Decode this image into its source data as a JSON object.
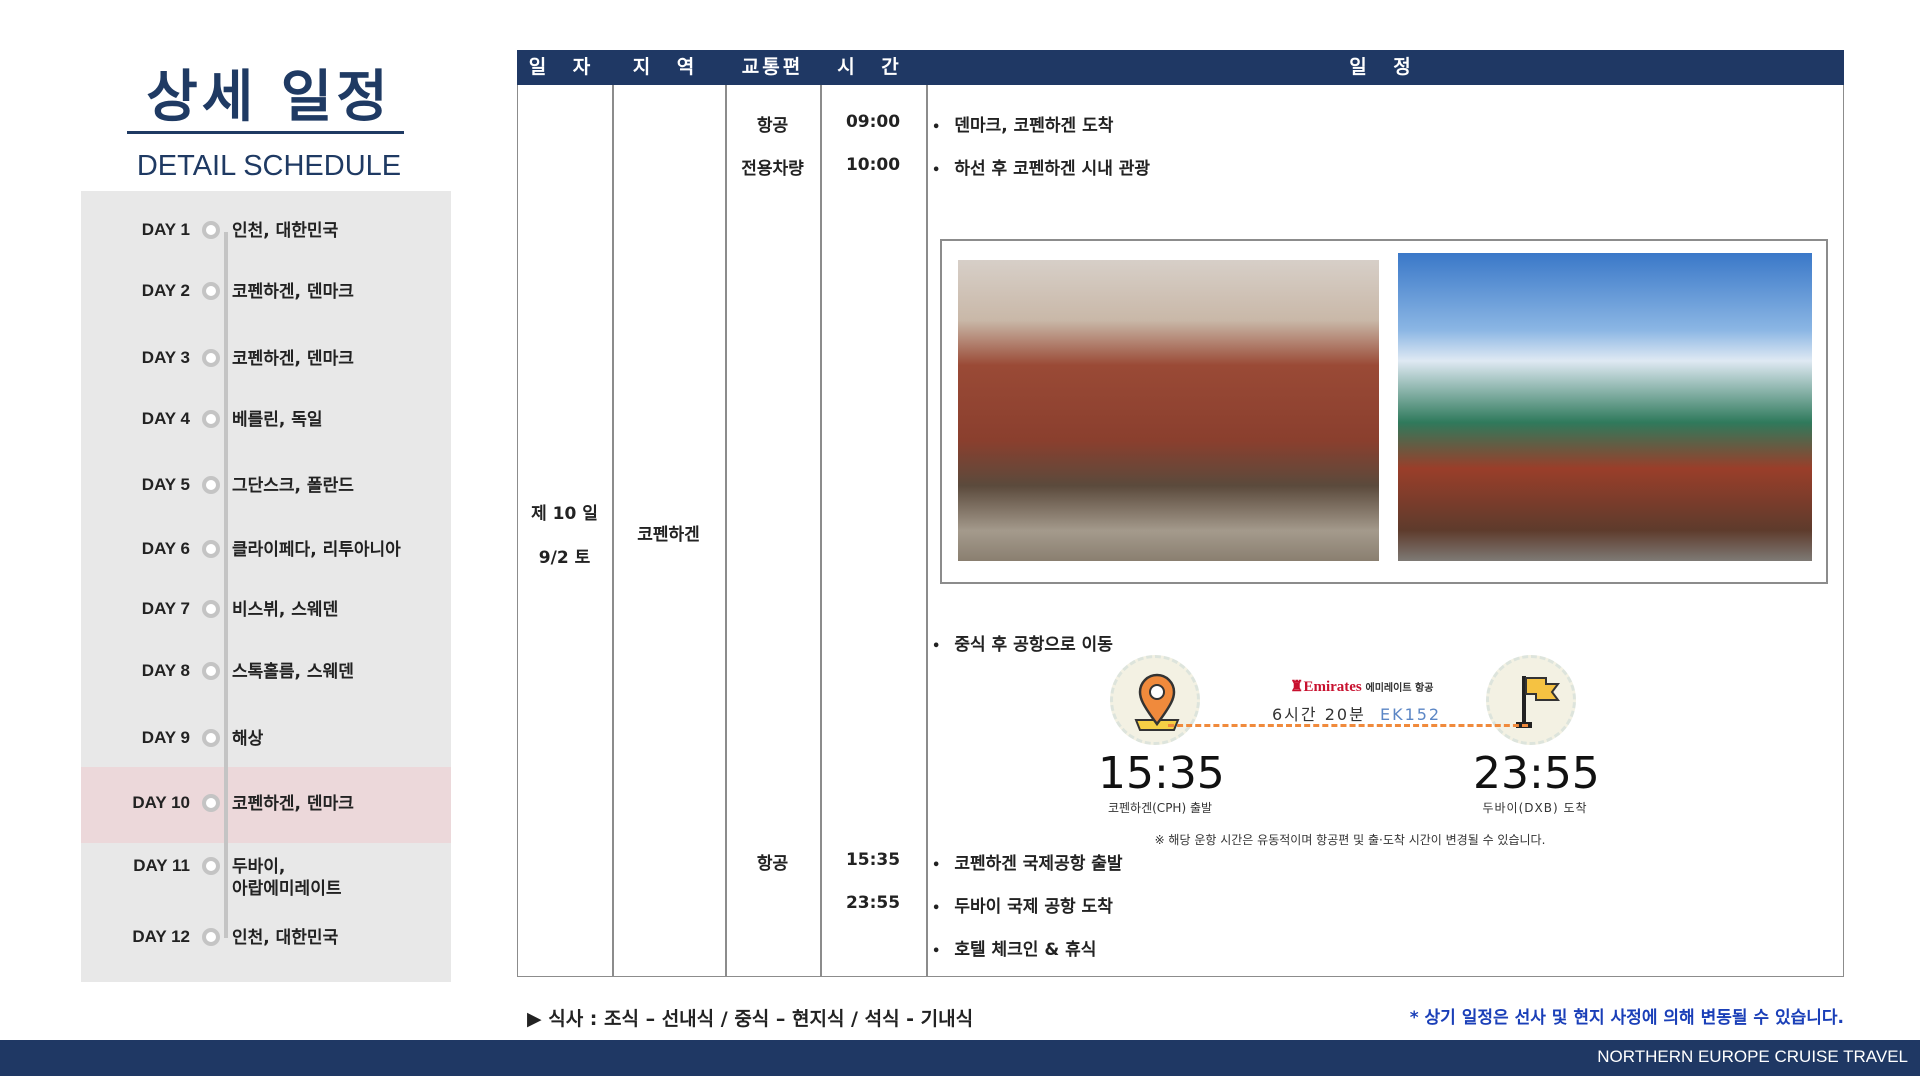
{
  "header": {
    "title": "상세 일정",
    "subtitle": "DETAIL SCHEDULE"
  },
  "sidebar": {
    "items": [
      {
        "day": "DAY 1",
        "place": "인천, 대한민국"
      },
      {
        "day": "DAY 2",
        "place": "코펜하겐, 덴마크"
      },
      {
        "day": "DAY 3",
        "place": "코펜하겐, 덴마크"
      },
      {
        "day": "DAY 4",
        "place": "베를린, 독일"
      },
      {
        "day": "DAY 5",
        "place": "그단스크, 폴란드"
      },
      {
        "day": "DAY 6",
        "place": "클라이페다, 리투아니아"
      },
      {
        "day": "DAY 7",
        "place": "비스뷔, 스웨덴"
      },
      {
        "day": "DAY 8",
        "place": "스톡홀름, 스웨덴"
      },
      {
        "day": "DAY 9",
        "place": "해상"
      },
      {
        "day": "DAY 10",
        "place": "코펜하겐, 덴마크",
        "active": true
      },
      {
        "day": "DAY 11",
        "place": "두바이,",
        "place2": "아랍에미레이트"
      },
      {
        "day": "DAY 12",
        "place": "인천, 대한민국"
      }
    ]
  },
  "table": {
    "headers": [
      "일 자",
      "지 역",
      "교통편",
      "시 간",
      "일 정"
    ],
    "day_label": "제 10 일",
    "date": "9/2 토",
    "region": "코펜하겐",
    "rows": [
      {
        "transport": "항공",
        "time": "09:00",
        "item": "덴마크, 코펜하겐 도착"
      },
      {
        "transport": "전용차량",
        "time": "10:00",
        "item": "하선 후 코펜하겐 시내 관광"
      },
      {
        "item": "중식 후 공항으로 이동"
      },
      {
        "transport": "항공",
        "time": "15:35",
        "item": "코펜하겐 국제공항 출발"
      },
      {
        "time": "23:55",
        "item": "두바이 국제 공항 도착"
      },
      {
        "item": "호텔 체크인 & 휴식"
      }
    ]
  },
  "flight": {
    "airline": "Emirates",
    "airline_kr": "에미레이트 항공",
    "duration": "6시간 20분",
    "flight_no": "EK152",
    "depart_time": "15:35",
    "depart_label": "코펜하겐(CPH) 출발",
    "arrive_time": "23:55",
    "arrive_label": "두바이(DXB) 도착",
    "note": "※ 해당 운항 시간은 유동적이며 항공편 및 출·도착 시간이 변경될 수 있습니다.",
    "colors": {
      "line": "#f08a3c",
      "flight_no": "#5b86c5",
      "airline": "#c8102e"
    }
  },
  "footer": {
    "meals": "▶ 식사 : 조식 – 선내식 / 중식 – 현지식 / 석식 - 기내식",
    "notice": "* 상기 일정은 선사 및 현지 사정에 의해 변동될 수 있습니다.",
    "brand": "NORTHERN EUROPE CRUISE TRAVEL"
  },
  "colors": {
    "navy": "#1f3864",
    "highlight": "#ecd8da",
    "sidebar": "#e8e8e8"
  }
}
